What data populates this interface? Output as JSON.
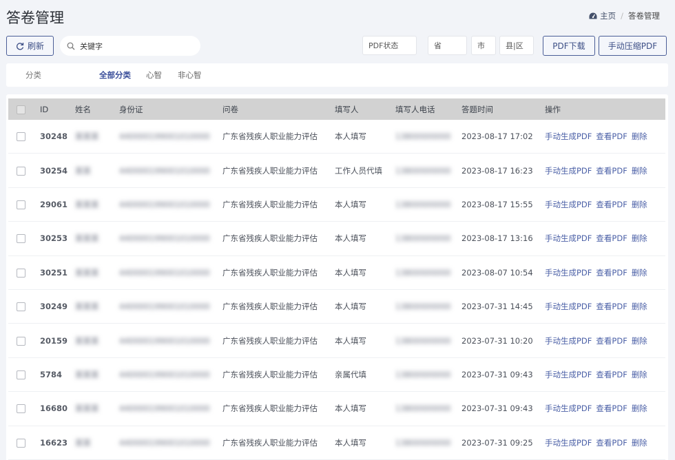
{
  "header": {
    "title": "答卷管理"
  },
  "breadcrumb": {
    "home": "主页",
    "current": "答卷管理"
  },
  "toolbar": {
    "refresh_label": "刷新",
    "search_placeholder": "关键字",
    "pdf_status": "PDF状态",
    "province": "省",
    "city": "市",
    "district": "县|区",
    "pdf_download": "PDF下载",
    "compress_pdf": "手动压缩PDF"
  },
  "filter": {
    "label": "分类",
    "options": [
      "全部分类",
      "心智",
      "非心智"
    ]
  },
  "table": {
    "columns": [
      "ID",
      "姓名",
      "身份证",
      "问卷",
      "填写人",
      "填写人电话",
      "答题时间",
      "操作"
    ],
    "actions": [
      "手动生成PDF",
      "查看PDF",
      "删除"
    ],
    "rows": [
      {
        "id": "30248",
        "name": "某某某",
        "idcard": "440000199001010000",
        "paper": "广东省残疾人职业能力评估",
        "filler": "本人填写",
        "phone": "13800000000",
        "time": "2023-08-17 17:02"
      },
      {
        "id": "30254",
        "name": "某某",
        "idcard": "440000199001010000",
        "paper": "广东省残疾人职业能力评估",
        "filler": "工作人员代填",
        "phone": "13800000000",
        "time": "2023-08-17 16:23"
      },
      {
        "id": "29061",
        "name": "某某某",
        "idcard": "440000199001010000",
        "paper": "广东省残疾人职业能力评估",
        "filler": "本人填写",
        "phone": "13800000000",
        "time": "2023-08-17 15:55"
      },
      {
        "id": "30253",
        "name": "某某某",
        "idcard": "440000199001010000",
        "paper": "广东省残疾人职业能力评估",
        "filler": "本人填写",
        "phone": "13800000000",
        "time": "2023-08-17 13:16"
      },
      {
        "id": "30251",
        "name": "某某某",
        "idcard": "440000199001010000",
        "paper": "广东省残疾人职业能力评估",
        "filler": "本人填写",
        "phone": "13800000000",
        "time": "2023-08-07 10:54"
      },
      {
        "id": "30249",
        "name": "某某某",
        "idcard": "440000199001010000",
        "paper": "广东省残疾人职业能力评估",
        "filler": "本人填写",
        "phone": "13800000000",
        "time": "2023-07-31 14:45"
      },
      {
        "id": "20159",
        "name": "某某某",
        "idcard": "440000199001010000",
        "paper": "广东省残疾人职业能力评估",
        "filler": "本人填写",
        "phone": "13800000000",
        "time": "2023-07-31 10:20"
      },
      {
        "id": "5784",
        "name": "某某某",
        "idcard": "440000199001010000",
        "paper": "广东省残疾人职业能力评估",
        "filler": "亲属代填",
        "phone": "13800000000",
        "time": "2023-07-31 09:43"
      },
      {
        "id": "16680",
        "name": "某某某",
        "idcard": "440000199001010000",
        "paper": "广东省残疾人职业能力评估",
        "filler": "本人填写",
        "phone": "13800000000",
        "time": "2023-07-31 09:43"
      },
      {
        "id": "16623",
        "name": "某某",
        "idcard": "440000199001010000",
        "paper": "广东省残疾人职业能力评估",
        "filler": "本人填写",
        "phone": "13800000000",
        "time": "2023-07-31 09:25"
      }
    ]
  },
  "icons": {
    "refresh": "refresh-icon",
    "search": "search-icon",
    "home": "dashboard-icon"
  },
  "colors": {
    "accent": "#3d4f86",
    "link": "#4a5fa6",
    "header_bg": "#d2d2d2",
    "page_bg": "#f2f4f8"
  }
}
